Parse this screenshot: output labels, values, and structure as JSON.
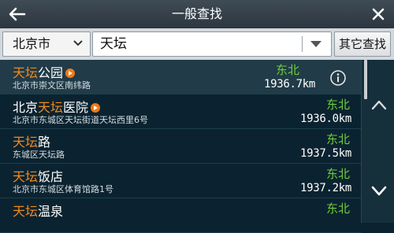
{
  "header": {
    "title": "一般查找",
    "back_icon": "back-arrow-icon",
    "close_icon": "close-icon"
  },
  "search": {
    "city": "北京市",
    "query": "天坛",
    "other_button": "其它查找"
  },
  "results": [
    {
      "prefix": "",
      "highlight": "天坛",
      "suffix": "公园",
      "poi": true,
      "address": "北京市崇文区南纬路",
      "direction": "东北",
      "distance": "1936.7km",
      "info": true
    },
    {
      "prefix": "北京",
      "highlight": "天坛",
      "suffix": "医院",
      "poi": true,
      "address": "北京市东城区天坛街道天坛西里6号",
      "direction": "东北",
      "distance": "1936.0km",
      "info": false
    },
    {
      "prefix": "",
      "highlight": "天坛",
      "suffix": "路",
      "poi": false,
      "address": "东城区天坛路",
      "direction": "东北",
      "distance": "1937.5km",
      "info": false
    },
    {
      "prefix": "",
      "highlight": "天坛",
      "suffix": "饭店",
      "poi": false,
      "address": "北京市东城区体育馆路1号",
      "direction": "东北",
      "distance": "1937.2km",
      "info": false
    },
    {
      "prefix": "",
      "highlight": "天坛",
      "suffix": "温泉",
      "poi": false,
      "address": "",
      "direction": "东北",
      "distance": "",
      "info": false
    }
  ],
  "colors": {
    "highlight": "#f08a1e",
    "direction": "#6fcf3a",
    "background": "#0b2330"
  }
}
